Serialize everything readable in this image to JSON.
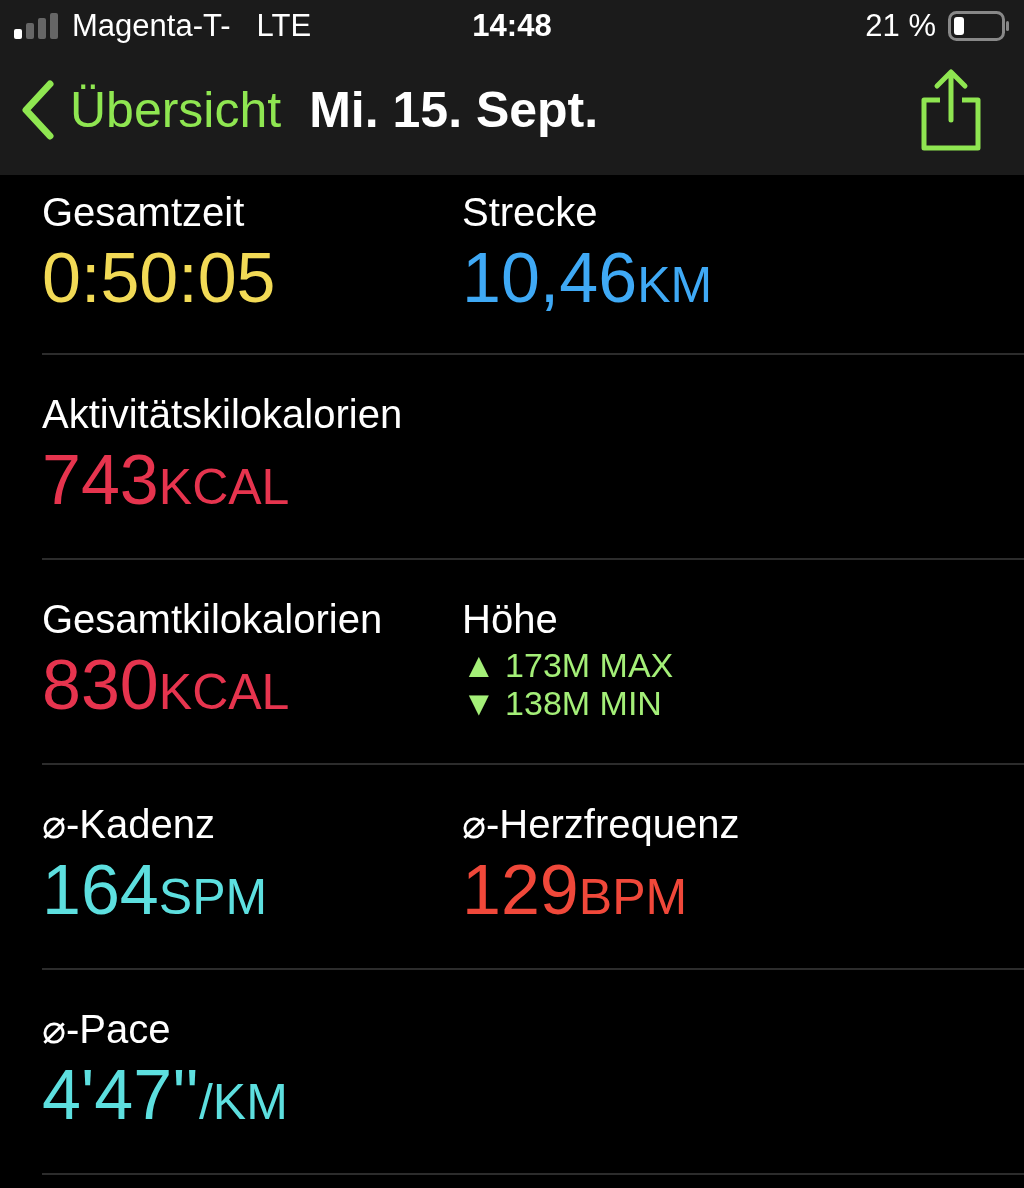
{
  "status_bar": {
    "carrier": "Magenta-T-",
    "network": "LTE",
    "time": "14:48",
    "battery": "21 %"
  },
  "nav": {
    "back": "Übersicht",
    "title": "Mi. 15. Sept."
  },
  "rows": [
    {
      "cells": [
        {
          "kind": "metric",
          "label": "Gesamtzeit",
          "value": "0:50:05",
          "color": "#f2da56"
        },
        {
          "kind": "metric",
          "label": "Strecke",
          "value": "10,46",
          "unit": "KM",
          "color": "#3fa9f5"
        }
      ]
    },
    {
      "cells": [
        {
          "kind": "metric",
          "label": "Aktivitätskilokalorien",
          "value": "743",
          "unit": "KCAL",
          "color": "#e6344e"
        }
      ]
    },
    {
      "cells": [
        {
          "kind": "metric",
          "label": "Gesamtkilokalorien",
          "value": "830",
          "unit": "KCAL",
          "color": "#e6344e"
        },
        {
          "kind": "elevation",
          "label": "Höhe",
          "lines": [
            "▲ 173M MAX",
            "▼ 138M MIN"
          ],
          "color": "#a4ef78"
        }
      ]
    },
    {
      "cells": [
        {
          "kind": "metric",
          "label": "⌀-Kadenz",
          "value": "164",
          "unit": "SPM",
          "color": "#5ddfdf"
        },
        {
          "kind": "metric",
          "label": "⌀-Herzfrequenz",
          "value": "129",
          "unit": "BPM",
          "color": "#f0483a"
        }
      ]
    },
    {
      "cells": [
        {
          "kind": "metric",
          "label": "⌀-Pace",
          "value": "4'47''",
          "unit": "/KM",
          "color": "#5ddfdf"
        }
      ]
    }
  ]
}
